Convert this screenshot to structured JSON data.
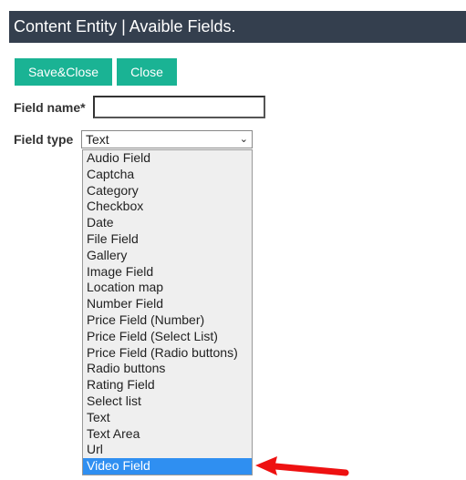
{
  "header": {
    "title": "Content Entity | Avaible Fields."
  },
  "toolbar": {
    "save_close_label": "Save&Close",
    "close_label": "Close"
  },
  "form": {
    "field_name": {
      "label": "Field name*",
      "value": "",
      "placeholder": ""
    },
    "field_type": {
      "label": "Field type",
      "selected": "Text",
      "options": [
        "Audio Field",
        "Captcha",
        "Category",
        "Checkbox",
        "Date",
        "File Field",
        "Gallery",
        "Image Field",
        "Location map",
        "Number Field",
        "Price Field (Number)",
        "Price Field (Select List)",
        "Price Field (Radio buttons)",
        "Radio buttons",
        "Rating Field",
        "Select list",
        "Text",
        "Text Area",
        "Url",
        "Video Field"
      ],
      "highlighted_option": "Video Field"
    }
  },
  "annotation": {
    "arrow_icon": "red-arrow-left-icon",
    "color": "#ee1111"
  },
  "colors": {
    "header_bg": "#343f4e",
    "button_bg": "#1ab394",
    "highlight": "#2f8ff1"
  }
}
